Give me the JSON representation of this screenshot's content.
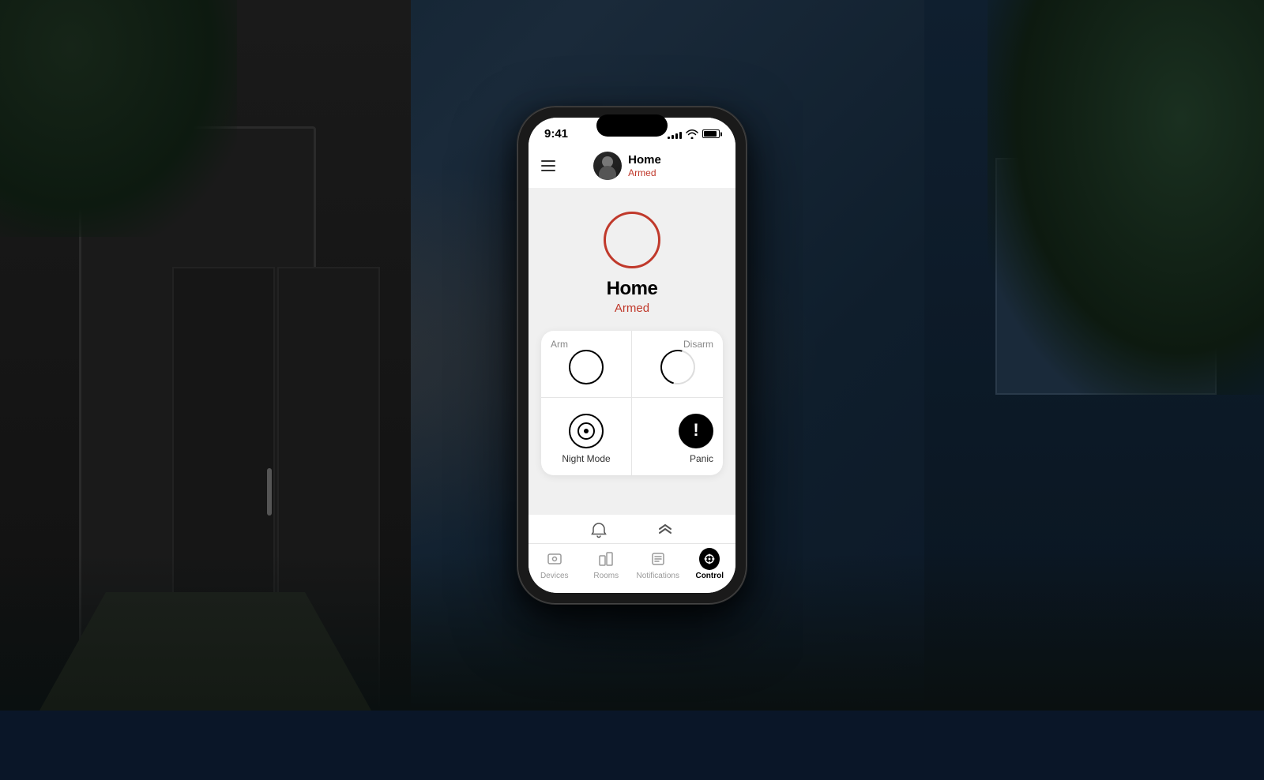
{
  "background": {
    "description": "Dark modern house exterior at night"
  },
  "phone": {
    "statusBar": {
      "time": "9:41",
      "signalBars": [
        3,
        5,
        7,
        9,
        11
      ],
      "wifiLabel": "wifi",
      "batteryLabel": "battery"
    },
    "header": {
      "menuIcon": "hamburger-icon",
      "avatarAlt": "user-avatar",
      "title": "Home",
      "status": "Armed"
    },
    "mainStatus": {
      "circleAlt": "armed-status-circle",
      "label": "Home",
      "subLabel": "Armed"
    },
    "controls": {
      "armLabel": "Arm",
      "disarmLabel": "Disarm",
      "nightModeLabel": "Night Mode",
      "panicLabel": "Panic"
    },
    "quickActions": {
      "bell": "notifications-icon",
      "chevronUp": "collapse-icon"
    },
    "tabBar": {
      "tabs": [
        {
          "id": "devices",
          "label": "Devices",
          "icon": "devices-icon",
          "active": false
        },
        {
          "id": "rooms",
          "label": "Rooms",
          "icon": "rooms-icon",
          "active": false
        },
        {
          "id": "notifications",
          "label": "Notifications",
          "icon": "notifications-tab-icon",
          "active": false
        },
        {
          "id": "control",
          "label": "Control",
          "icon": "control-icon",
          "active": true
        }
      ]
    }
  }
}
